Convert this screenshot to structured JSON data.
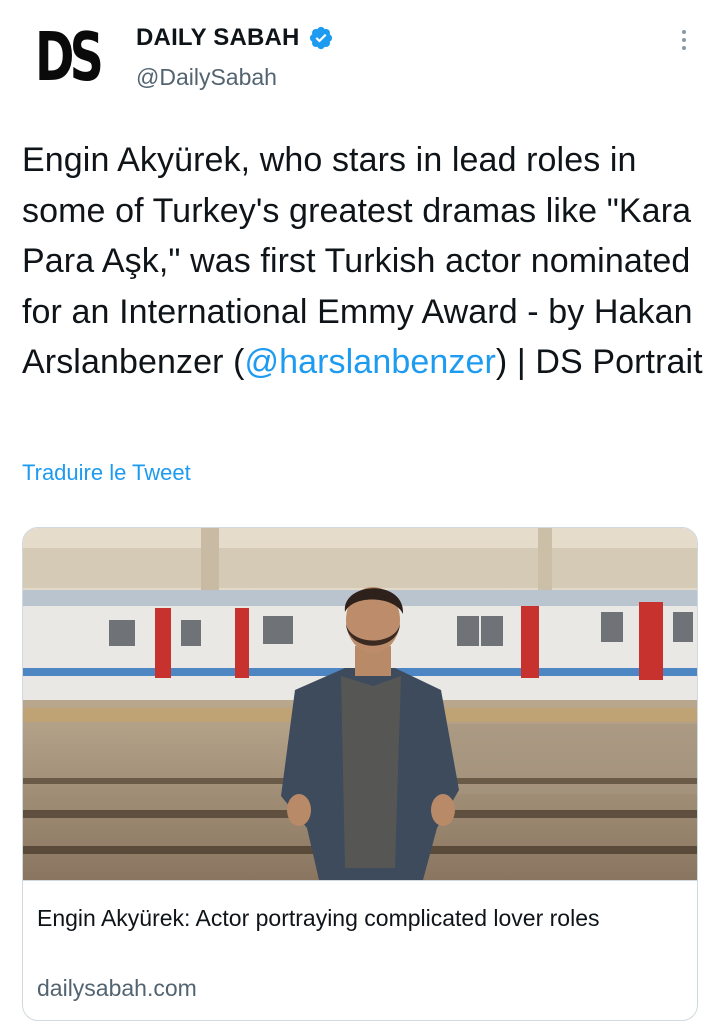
{
  "account": {
    "display_name": "DAILY SABAH",
    "handle": "@DailySabah",
    "avatar_text": "DS",
    "verified": true
  },
  "tweet": {
    "text_before": "Engin Akyürek, who stars in lead roles in some of Turkey's greatest dramas like \"Kara Para Aşk,\" was first Turkish actor nominated for an International Emmy Award - by Hakan Arslanbenzer (",
    "mention": "@harslanbenzer",
    "text_after": ") | DS Portrait",
    "translate_label": "Traduire le Tweet"
  },
  "card": {
    "title": "Engin Akyürek: Actor portraying complicated lover roles",
    "domain": "dailysabah.com"
  },
  "icons": {
    "verified": "verified-badge-icon",
    "more": "more-options-icon"
  },
  "colors": {
    "accent": "#1d9bf0",
    "secondary_text": "#536471",
    "border": "#cfd9de"
  }
}
